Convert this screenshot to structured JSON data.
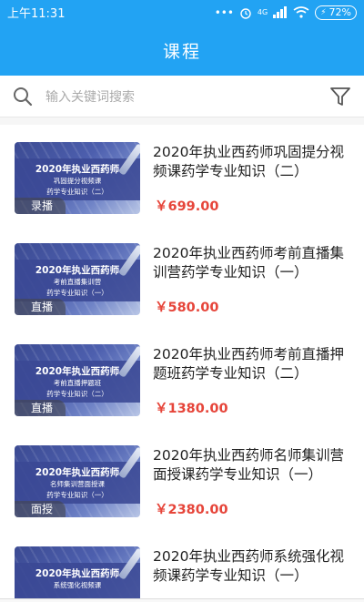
{
  "status_bar": {
    "time": "上午11:31",
    "dots": "•••",
    "network": "4G",
    "battery_pct": "72%"
  },
  "header": {
    "title": "课程"
  },
  "search": {
    "placeholder": "输入关键词搜索"
  },
  "courses": [
    {
      "title": "2020年执业西药师巩固提分视频课药学专业知识（二）",
      "price": "￥699.00",
      "tag": "录播",
      "thumb_line1": "2020年执业西药师",
      "thumb_line2": "巩固提分视频课",
      "thumb_line3": "药学专业知识（二）"
    },
    {
      "title": "2020年执业西药师考前直播集训营药学专业知识（一）",
      "price": "￥580.00",
      "tag": "直播",
      "thumb_line1": "2020年执业西药师",
      "thumb_line2": "考前直播集训营",
      "thumb_line3": "药学专业知识（一）"
    },
    {
      "title": "2020年执业西药师考前直播押题班药学专业知识（二）",
      "price": "￥1380.00",
      "tag": "直播",
      "thumb_line1": "2020年执业西药师",
      "thumb_line2": "考前直播押题班",
      "thumb_line3": "药学专业知识（二）"
    },
    {
      "title": "2020年执业西药师名师集训营面授课药学专业知识（一）",
      "price": "￥2380.00",
      "tag": "面授",
      "thumb_line1": "2020年执业西药师",
      "thumb_line2": "名师集训营面授课",
      "thumb_line3": "药学专业知识（一）"
    },
    {
      "title": "2020年执业西药师系统强化视频课药学专业知识（一）",
      "price": "",
      "tag": "",
      "thumb_line1": "2020年执业西药师",
      "thumb_line2": "系统强化视频课",
      "thumb_line3": ""
    }
  ]
}
